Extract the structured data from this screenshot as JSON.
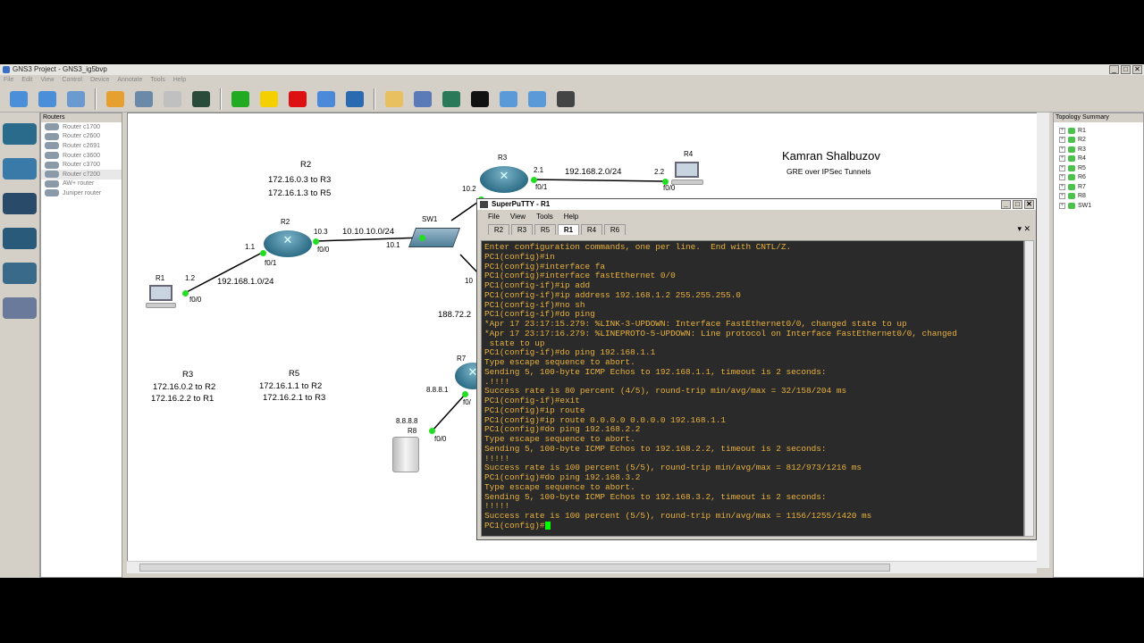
{
  "window": {
    "title": "GNS3 Project - GNS3_ig5bvp",
    "controls": [
      "_",
      "□",
      "✕"
    ]
  },
  "menu": [
    "File",
    "Edit",
    "View",
    "Control",
    "Device",
    "Annotate",
    "Tools",
    "Help"
  ],
  "toolbar": [
    {
      "icon": "new-project-icon",
      "color": "#4a8fd8"
    },
    {
      "icon": "open-project-icon",
      "color": "#4a8fd8"
    },
    {
      "icon": "save-project-icon",
      "color": "#6a9ad0"
    },
    {
      "icon": "snapshot-icon",
      "color": "#e6a030"
    },
    {
      "icon": "add-link-icon",
      "color": "#6a8aa8"
    },
    {
      "icon": "capture-icon",
      "color": "#c0c0c0"
    },
    {
      "icon": "console-icon",
      "color": "#2a4a3a"
    },
    {
      "icon": "start-icon",
      "color": "#22aa22"
    },
    {
      "icon": "pause-icon",
      "color": "#f4d000"
    },
    {
      "icon": "stop-icon",
      "color": "#dd1111"
    },
    {
      "icon": "reload-icon",
      "color": "#4a8ad8"
    },
    {
      "icon": "virtualbox-icon",
      "color": "#2a6ab0"
    },
    {
      "icon": "note-icon",
      "color": "#e8c060"
    },
    {
      "icon": "insert-picture-icon",
      "color": "#5a7ab8"
    },
    {
      "icon": "rectangle-icon",
      "color": "#2a7a5a"
    },
    {
      "icon": "ellipse-icon",
      "color": "#111111"
    },
    {
      "icon": "zoom-in-icon",
      "color": "#5a9ad8"
    },
    {
      "icon": "zoom-out-icon",
      "color": "#5a9ad8"
    },
    {
      "icon": "screenshot-icon",
      "color": "#444444"
    }
  ],
  "device_types": [
    "router-category-icon",
    "switch-category-icon",
    "end-device-category-icon",
    "security-device-category-icon",
    "all-devices-icon",
    "connection-icon"
  ],
  "routers_panel": {
    "title": "Routers",
    "items": [
      "Router c1700",
      "Router c2600",
      "Router c2691",
      "Router c3600",
      "Router c3700",
      "Router c7200",
      "AW+ router",
      "Juniper router"
    ],
    "selected_index": 5
  },
  "topology_summary": {
    "title": "Topology Summary",
    "items": [
      "R1",
      "R2",
      "R3",
      "R4",
      "R5",
      "R6",
      "R7",
      "R8",
      "SW1"
    ]
  },
  "canvas": {
    "author": "Kamran Shalbuzov",
    "subtitle": "GRE over IPSec Tunnels",
    "notes": {
      "r2_title": "R2",
      "r2_line1": "172.16.0.3 to R3",
      "r2_line2": "172.16.1.3 to R5",
      "r3_title": "R3",
      "r3_line1": "172.16.0.2 to R2",
      "r3_line2": "172.16.2.2 to R1",
      "r5_title": "R5",
      "r5_line1": "172.16.1.1 to R2",
      "r5_line2": "172.16.2.1 to R3"
    },
    "nodes": {
      "r1": "R1",
      "r2": "R2",
      "r3": "R3",
      "r4": "R4",
      "r7": "R7",
      "r8": "R8",
      "sw1": "SW1"
    },
    "labels": {
      "r1_ip": "1.2",
      "r1_iface": "f0/0",
      "net_r1r2": "192.168.1.0/24",
      "r2_left_ip": "1.1",
      "r2_left_iface": "f0/1",
      "r2_right_ip": "10.3",
      "r2_right_iface": "f0/0",
      "net_r2sw": "10.10.10.0/24",
      "sw_left_ip": "10.1",
      "r3_left_ip": "10.2",
      "r3_right_ip": "2.1",
      "r3_iface": "f0/1",
      "net_r3r4": "192.168.2.0/24",
      "r4_ip": "2.2",
      "r4_iface": "f0/0",
      "sw_right_ip": "10",
      "net_partial": "188.72.2",
      "r7_ip": "8.8.8.1",
      "r7_iface": "f0/",
      "r8_ip": "8.8.8.8",
      "r8_iface": "f0/0"
    }
  },
  "putty": {
    "title": "SuperPuTTY - R1",
    "menu": [
      "File",
      "View",
      "Tools",
      "Help"
    ],
    "tabs": [
      "R2",
      "R3",
      "R5",
      "R1",
      "R4",
      "R6"
    ],
    "active_tab": "R1",
    "tab_controls": "▾ ✕",
    "terminal": [
      "Enter configuration commands, one per line.  End with CNTL/Z.",
      "PC1(config)#in",
      "PC1(config)#interface fa",
      "PC1(config)#interface fastEthernet 0/0",
      "PC1(config-if)#ip add",
      "PC1(config-if)#ip address 192.168.1.2 255.255.255.0",
      "PC1(config-if)#no sh",
      "PC1(config-if)#do ping",
      "*Apr 17 23:17:15.279: %LINK-3-UPDOWN: Interface FastEthernet0/0, changed state to up",
      "*Apr 17 23:17:16.279: %LINEPROTO-5-UPDOWN: Line protocol on Interface FastEthernet0/0, changed",
      " state to up",
      "PC1(config-if)#do ping 192.168.1.1",
      "Type escape sequence to abort.",
      "Sending 5, 100-byte ICMP Echos to 192.168.1.1, timeout is 2 seconds:",
      ".!!!!",
      "Success rate is 80 percent (4/5), round-trip min/avg/max = 32/158/204 ms",
      "PC1(config-if)#exit",
      "PC1(config)#ip route",
      "PC1(config)#ip route 0.0.0.0 0.0.0.0 192.168.1.1",
      "PC1(config)#do ping 192.168.2.2",
      "Type escape sequence to abort.",
      "Sending 5, 100-byte ICMP Echos to 192.168.2.2, timeout is 2 seconds:",
      "!!!!!",
      "Success rate is 100 percent (5/5), round-trip min/avg/max = 812/973/1216 ms",
      "PC1(config)#do ping 192.168.3.2",
      "Type escape sequence to abort.",
      "Sending 5, 100-byte ICMP Echos to 192.168.3.2, timeout is 2 seconds:",
      "!!!!!",
      "Success rate is 100 percent (5/5), round-trip min/avg/max = 1156/1255/1420 ms"
    ],
    "prompt": "PC1(config)#"
  },
  "colors": {
    "terminal_bg": "#2a2a2a",
    "terminal_fg": "#e9b23e",
    "link_up": "#22dd22",
    "router": "#2f6f88"
  }
}
